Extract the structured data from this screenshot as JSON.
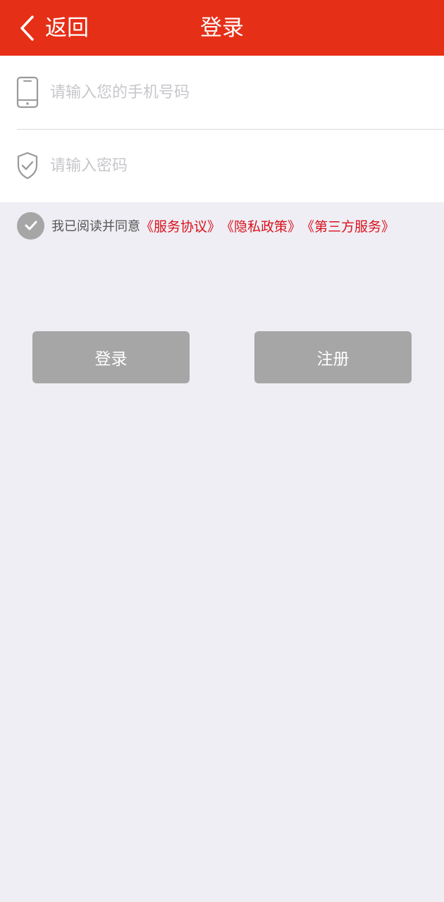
{
  "header": {
    "back_label": "返回",
    "title": "登录"
  },
  "form": {
    "phone_placeholder": "请输入您的手机号码",
    "phone_value": "",
    "password_placeholder": "请输入密码",
    "password_value": ""
  },
  "agreement": {
    "checked": true,
    "text": "我已阅读并同意",
    "links": [
      "《服务协议》",
      "《隐私政策》",
      "《第三方服务》"
    ]
  },
  "buttons": {
    "login_label": "登录",
    "register_label": "注册"
  },
  "colors": {
    "header_bg": "#e62f17",
    "background": "#efeef4",
    "button_bg": "#a6a6a6",
    "link": "#d8121d"
  },
  "icons": {
    "back": "chevron-left-icon",
    "phone": "mobile-phone-icon",
    "password": "shield-check-icon",
    "agree": "checkmark-circle-icon"
  }
}
